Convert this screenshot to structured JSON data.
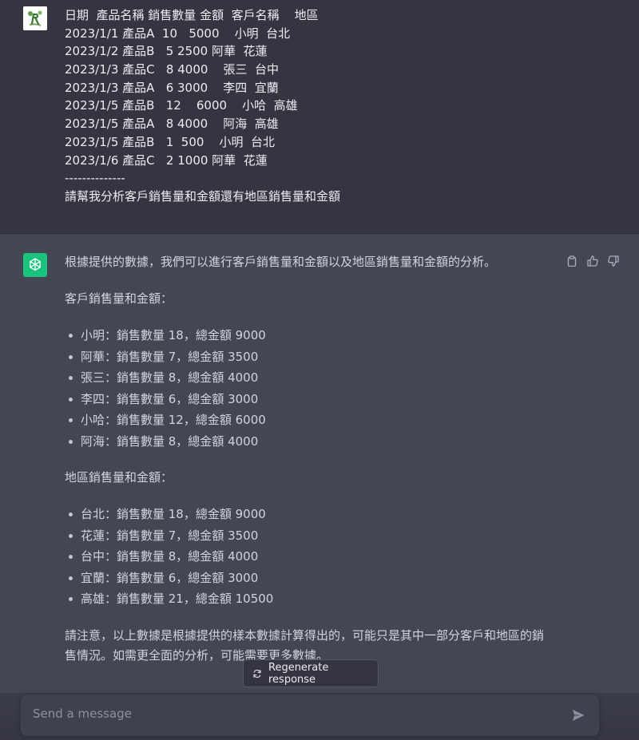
{
  "user_message": {
    "lines": [
      "日期  產品名稱 銷售數量 金額  客戶名稱    地區",
      "2023/1/1 產品A  10   5000    小明  台北",
      "2023/1/2 產品B   5 2500 阿華  花蓮",
      "2023/1/3 產品C   8 4000    張三  台中",
      "2023/1/3 產品A   6 3000    李四  宜蘭",
      "2023/1/5 產品B   12    6000    小哈  高雄",
      "2023/1/5 產品A   8 4000    阿海  高雄",
      "2023/1/5 產品B   1  500    小明  台北",
      "2023/1/6 產品C   2 1000 阿華  花蓮",
      "--------------",
      "請幫我分析客戶銷售量和金額還有地區銷售量和金額"
    ]
  },
  "assistant_message": {
    "intro": "根據提供的數據，我們可以進行客戶銷售量和金額以及地區銷售量和金額的分析。",
    "customer_heading": "客戶銷售量和金額：",
    "customer_items": [
      "小明：銷售數量 18，總金額 9000",
      "阿華：銷售數量 7，總金額 3500",
      "張三：銷售數量 8，總金額 4000",
      "李四：銷售數量 6，總金額 3000",
      "小哈：銷售數量 12，總金額 6000",
      "阿海：銷售數量 8，總金額 4000"
    ],
    "region_heading": "地區銷售量和金額：",
    "region_items": [
      "台北：銷售數量 18，總金額 9000",
      "花蓮：銷售數量 7，總金額 3500",
      "台中：銷售數量 8，總金額 4000",
      "宜蘭：銷售數量 6，總金額 3000",
      "高雄：銷售數量 21，總金額 10500"
    ],
    "note_line1": "請注意，以上數據是根據提供的樣本數據計算得出的，可能只是其中一部分客戶和地區的銷",
    "note_line2": "售情況。如需更全面的分析，可能需要更多數據。"
  },
  "actions": {
    "copy_icon": "clipboard-icon",
    "like_icon": "thumbs-up-icon",
    "dislike_icon": "thumbs-down-icon"
  },
  "regenerate": {
    "label": "Regenerate response",
    "icon": "refresh-icon"
  },
  "composer": {
    "placeholder": "Send a message",
    "send_icon": "send-icon"
  },
  "colors": {
    "user_bg": "#343541",
    "assistant_bg": "#444654",
    "gpt_avatar": "#19c37d",
    "input_bg": "#40414f"
  }
}
